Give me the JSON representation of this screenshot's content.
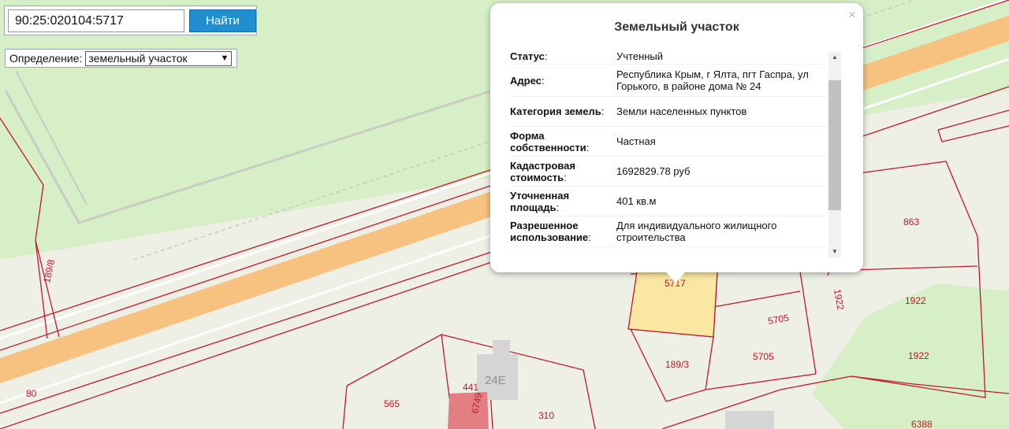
{
  "search": {
    "query": "90:25:020104:5717",
    "button_label": "Найти"
  },
  "definition": {
    "label": "Определение:",
    "selected": "земельный участок"
  },
  "popup": {
    "title": "Земельный участок",
    "close_glyph": "×",
    "rows": [
      {
        "key": "Статус",
        "value": "Учтенный"
      },
      {
        "key": "Адрес",
        "value": "Республика Крым, г Ялта, пгт Гаспра, ул Горького, в районе дома № 24"
      },
      {
        "key": "Категория земель",
        "value": "Земли населенных пунктов"
      },
      {
        "key": "Форма собственности",
        "value": "Частная"
      },
      {
        "key": "Кадастровая стоимость",
        "value": "1692829.78 руб"
      },
      {
        "key": "Уточненная площадь",
        "value": "401 кв.м"
      },
      {
        "key": "Разрешенное использование",
        "value": "Для индивидуального жилищного строительства"
      }
    ]
  },
  "map_labels": {
    "p189_8": "189/8",
    "p80": "80",
    "p565": "565",
    "p441": "441",
    "p6749": "6749",
    "p24e": "24Е",
    "p310": "310",
    "p5717": "5717",
    "p189_3": "189/3",
    "p5705a": "5705",
    "p5705b": "5705",
    "p863": "863",
    "p1922a": "1922",
    "p1922b": "1922",
    "p1922c": "1922",
    "p6388": "6388"
  },
  "colors": {
    "parcel_border": "#c0192b",
    "selected_fill": "#fbe79a",
    "road": "#f7c17f",
    "green": "#d6efc6",
    "button": "#1f8fd0"
  }
}
